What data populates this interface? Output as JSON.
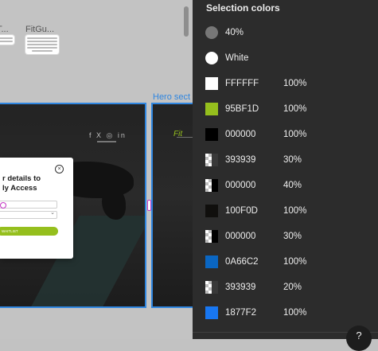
{
  "canvas": {
    "tile_labels": [
      "T...",
      "FitGu..."
    ],
    "frame_label": "Hero sect",
    "social_icons": "f X ◎ in",
    "modal": {
      "title_line1": "r details to",
      "title_line2": "ly Access",
      "button_label": "WAITLIST",
      "close_symbol": "×"
    },
    "brand_logo": "Fit"
  },
  "panel": {
    "title": "Selection colors",
    "colors": [
      {
        "swatch": "circle",
        "color": "#777777",
        "label": "40%",
        "percent": ""
      },
      {
        "swatch": "circle",
        "color": "#FFFFFF",
        "label": "White",
        "percent": ""
      },
      {
        "swatch": "square",
        "color": "#FFFFFF",
        "label": "FFFFFF",
        "percent": "100%"
      },
      {
        "swatch": "square",
        "color": "#95BF1D",
        "label": "95BF1D",
        "percent": "100%"
      },
      {
        "swatch": "square",
        "color": "#000000",
        "label": "000000",
        "percent": "100%"
      },
      {
        "swatch": "half",
        "color": "#393939",
        "label": "393939",
        "percent": "30%"
      },
      {
        "swatch": "half",
        "color": "#000000",
        "label": "000000",
        "percent": "40%"
      },
      {
        "swatch": "square",
        "color": "#100F0D",
        "label": "100F0D",
        "percent": "100%"
      },
      {
        "swatch": "half",
        "color": "#000000",
        "label": "000000",
        "percent": "30%"
      },
      {
        "swatch": "square",
        "color": "#0A66C2",
        "label": "0A66C2",
        "percent": "100%"
      },
      {
        "swatch": "half",
        "color": "#393939",
        "label": "393939",
        "percent": "20%"
      },
      {
        "swatch": "square",
        "color": "#1877F2",
        "label": "1877F2",
        "percent": "100%"
      }
    ],
    "help_label": "?"
  }
}
